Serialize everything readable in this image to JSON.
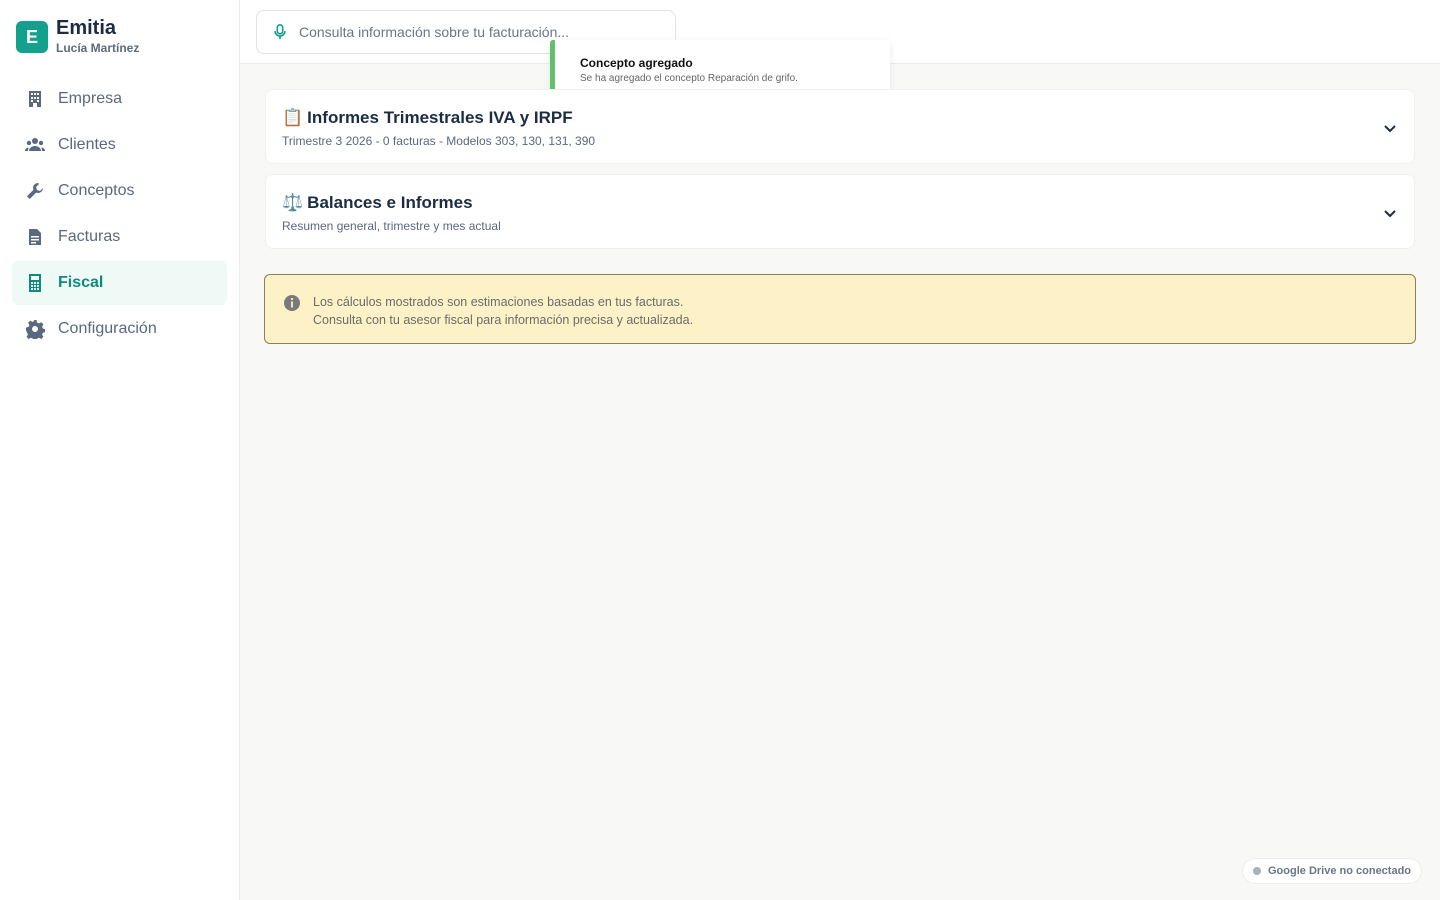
{
  "brand": {
    "logo_letter": "E",
    "name": "Emitia",
    "user": "Lucía Martínez",
    "accent": "#13a08d"
  },
  "nav": {
    "items": [
      {
        "label": "Empresa",
        "icon": "building-icon",
        "active": false
      },
      {
        "label": "Clientes",
        "icon": "users-icon",
        "active": false
      },
      {
        "label": "Conceptos",
        "icon": "wrench-icon",
        "active": false
      },
      {
        "label": "Facturas",
        "icon": "document-icon",
        "active": false
      },
      {
        "label": "Fiscal",
        "icon": "calculator-icon",
        "active": true
      },
      {
        "label": "Configuración",
        "icon": "gear-icon",
        "active": false
      }
    ]
  },
  "search": {
    "placeholder": "Consulta información sobre tu facturación..."
  },
  "toast": {
    "title": "Concepto agregado",
    "message": "Se ha agregado el concepto Reparación de grifo.",
    "color": "#5fc26a"
  },
  "sections": [
    {
      "emoji": "📋",
      "title": "Informes Trimestrales IVA y IRPF",
      "subtitle": "Trimestre 3 2026 - 0 facturas - Modelos 303, 130, 131, 390"
    },
    {
      "emoji": "⚖️",
      "title": "Balances e Informes",
      "subtitle": "Resumen general, trimestre y mes actual"
    }
  ],
  "notice": {
    "line1": "Los cálculos mostrados son estimaciones basadas en tus facturas.",
    "line2": "Consulta con tu asesor fiscal para información precisa y actualizada."
  },
  "drive_status": {
    "label": "Google Drive no conectado"
  }
}
